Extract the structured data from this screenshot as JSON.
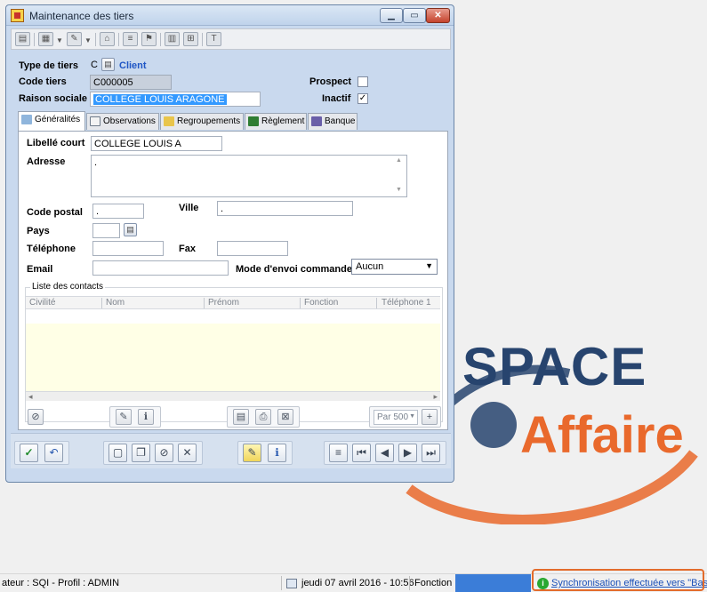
{
  "window": {
    "title": "Maintenance des tiers",
    "min_label": "▁",
    "max_label": "▭",
    "close_label": "✕"
  },
  "form": {
    "type_label": "Type de tiers",
    "type_code": "C",
    "type_value": "Client",
    "code_label": "Code tiers",
    "code_value": "C000005",
    "raison_label": "Raison sociale",
    "raison_value": "COLLEGE LOUIS ARAGONE",
    "prospect_label": "Prospect",
    "prospect_checked": false,
    "inactif_label": "Inactif",
    "inactif_checked": true
  },
  "tabs": [
    {
      "label": "Généralités",
      "icon": "general-icon",
      "active": true
    },
    {
      "label": "Observations",
      "icon": "notes-icon"
    },
    {
      "label": "Regroupements",
      "icon": "groups-icon"
    },
    {
      "label": "Règlement",
      "icon": "payment-icon"
    },
    {
      "label": "Banque",
      "icon": "bank-icon"
    }
  ],
  "general": {
    "libelle_label": "Libellé court",
    "libelle_value": "COLLEGE LOUIS A",
    "adresse_label": "Adresse",
    "adresse_value": ".",
    "cp_label": "Code postal",
    "cp_value": ".",
    "ville_label": "Ville",
    "ville_value": ".",
    "pays_label": "Pays",
    "pays_value": "",
    "tel_label": "Téléphone",
    "tel_value": "",
    "fax_label": "Fax",
    "fax_value": "",
    "email_label": "Email",
    "email_value": "",
    "mode_label": "Mode d'envoi commande",
    "mode_value": "Aucun"
  },
  "contacts": {
    "title": "Liste des contacts",
    "columns": [
      "Civilité",
      "Nom",
      "Prénom",
      "Fonction",
      "Téléphone 1"
    ],
    "paging": "Par 500"
  },
  "status": {
    "user": "ateur : SQI - Profil : ADMIN",
    "date": "jeudi 07 avril 2016 - 10:56",
    "fonction": "Fonction :",
    "sync": "Synchronisation effectuée vers \"Base\"."
  },
  "logo": {
    "line1": "SPACE",
    "line2": "Affaire",
    "color1": "#27446e",
    "color2": "#e9692c"
  },
  "colors": {
    "accent": "#3399ff",
    "window_bg": "#c9d9ee",
    "grid_bg": "#ffffe6"
  }
}
